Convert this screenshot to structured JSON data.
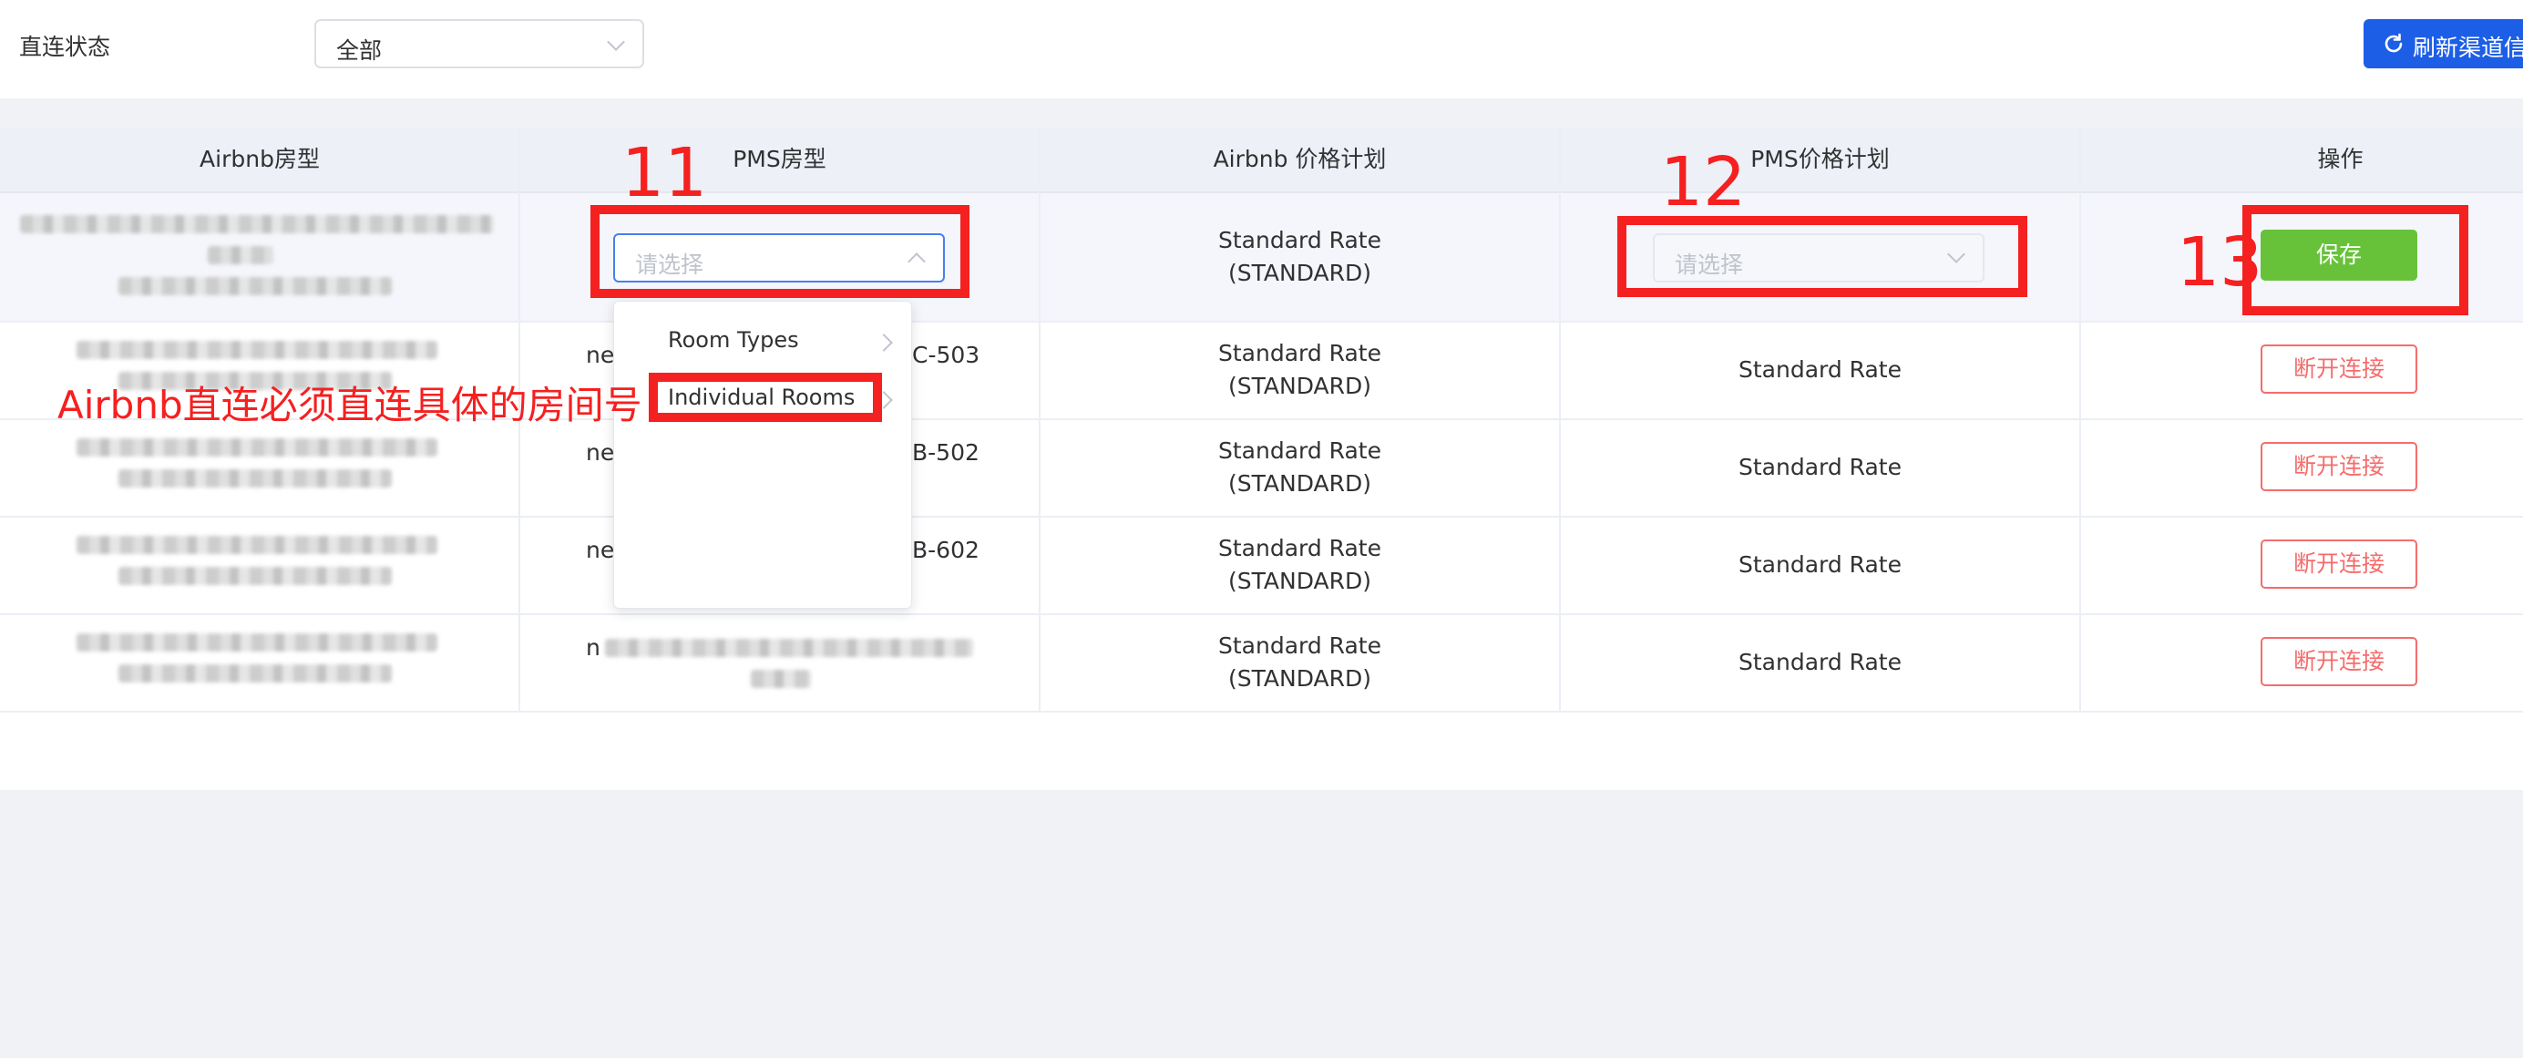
{
  "filter": {
    "label": "直连状态",
    "value": "全部"
  },
  "toolbar": {
    "refresh_label": "刷新渠道信"
  },
  "table": {
    "columns": [
      "Airbnb房型",
      "PMS房型",
      "Airbnb 价格计划",
      "PMS价格计划",
      "操作"
    ],
    "edit_row": {
      "pms_room_placeholder": "请选择",
      "airbnb_rate": [
        "Standard Rate",
        "(STANDARD)"
      ],
      "pms_rate_placeholder": "请选择",
      "save_label": "保存"
    },
    "rows": [
      {
        "pms_room_prefix": "nes",
        "pms_room_suffix": "C-503",
        "airbnb_rate": [
          "Standard Rate",
          "(STANDARD)"
        ],
        "pms_rate": "Standard Rate",
        "action": "断开连接"
      },
      {
        "pms_room_prefix": "nes",
        "pms_room_suffix": "B-502",
        "airbnb_rate": [
          "Standard Rate",
          "(STANDARD)"
        ],
        "pms_rate": "Standard Rate",
        "action": "断开连接"
      },
      {
        "pms_room_prefix": "nes",
        "pms_room_suffix": "B-602",
        "airbnb_rate": [
          "Standard Rate",
          "(STANDARD)"
        ],
        "pms_rate": "Standard Rate",
        "action": "断开连接"
      },
      {
        "pms_room_prefix": "n",
        "pms_room_suffix": "",
        "airbnb_rate": [
          "Standard Rate",
          "(STANDARD)"
        ],
        "pms_rate": "Standard Rate",
        "action": "断开连接"
      }
    ]
  },
  "dropdown": {
    "items": [
      "Room Types",
      "Individual Rooms"
    ]
  },
  "annotations": {
    "num_11": "11",
    "num_12": "12",
    "num_13": "13",
    "note": "Airbnb直连必须直连具体的房间号",
    "color": "#f52020"
  },
  "colors": {
    "primary": "#1d5ee6",
    "success": "#67c23a",
    "danger": "#f56c6c"
  }
}
